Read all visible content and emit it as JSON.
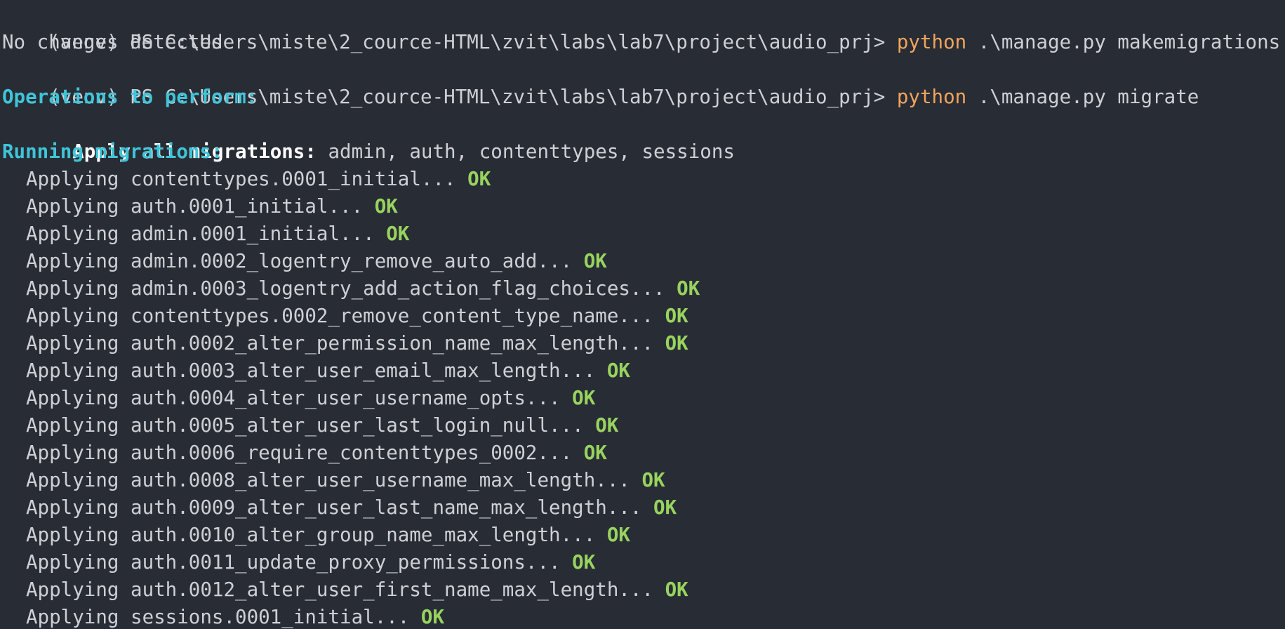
{
  "terminal": {
    "prompt1": {
      "venv": "(venv)",
      "path": " PS C:\\Users\\miste\\2_cource-HTML\\zvit\\labs\\lab7\\project\\audio_prj> ",
      "command": "python",
      "args": " .\\manage.py makemigrations"
    },
    "output1": "No changes detected",
    "prompt2": {
      "venv": "(venv)",
      "path": " PS C:\\Users\\miste\\2_cource-HTML\\zvit\\labs\\lab7\\project\\audio_prj> ",
      "command": "python",
      "args": " .\\manage.py migrate"
    },
    "operations_heading": "Operations to perform:",
    "apply_all_label": "Apply all migrations:",
    "apply_all_value": " admin, auth, contenttypes, sessions",
    "running_heading": "Running migrations:",
    "migrations": [
      {
        "text": "Applying contenttypes.0001_initial... ",
        "status": "OK"
      },
      {
        "text": "Applying auth.0001_initial... ",
        "status": "OK"
      },
      {
        "text": "Applying admin.0001_initial... ",
        "status": "OK"
      },
      {
        "text": "Applying admin.0002_logentry_remove_auto_add... ",
        "status": "OK"
      },
      {
        "text": "Applying admin.0003_logentry_add_action_flag_choices... ",
        "status": "OK"
      },
      {
        "text": "Applying contenttypes.0002_remove_content_type_name... ",
        "status": "OK"
      },
      {
        "text": "Applying auth.0002_alter_permission_name_max_length... ",
        "status": "OK"
      },
      {
        "text": "Applying auth.0003_alter_user_email_max_length... ",
        "status": "OK"
      },
      {
        "text": "Applying auth.0004_alter_user_username_opts... ",
        "status": "OK"
      },
      {
        "text": "Applying auth.0005_alter_user_last_login_null... ",
        "status": "OK"
      },
      {
        "text": "Applying auth.0006_require_contenttypes_0002... ",
        "status": "OK"
      },
      {
        "text": "Applying auth.0008_alter_user_username_max_length... ",
        "status": "OK"
      },
      {
        "text": "Applying auth.0009_alter_user_last_name_max_length... ",
        "status": "OK"
      },
      {
        "text": "Applying auth.0010_alter_group_name_max_length... ",
        "status": "OK"
      },
      {
        "text": "Applying auth.0011_update_proxy_permissions... ",
        "status": "OK"
      },
      {
        "text": "Applying auth.0012_alter_user_first_name_max_length... ",
        "status": "OK"
      },
      {
        "text": "Applying sessions.0001_initial... ",
        "status": "OK"
      }
    ]
  },
  "colors": {
    "background": "#282c34",
    "text": "#cdd0d6",
    "command": "#f0a45d",
    "heading": "#3fc4d8",
    "ok": "#98d35f"
  }
}
